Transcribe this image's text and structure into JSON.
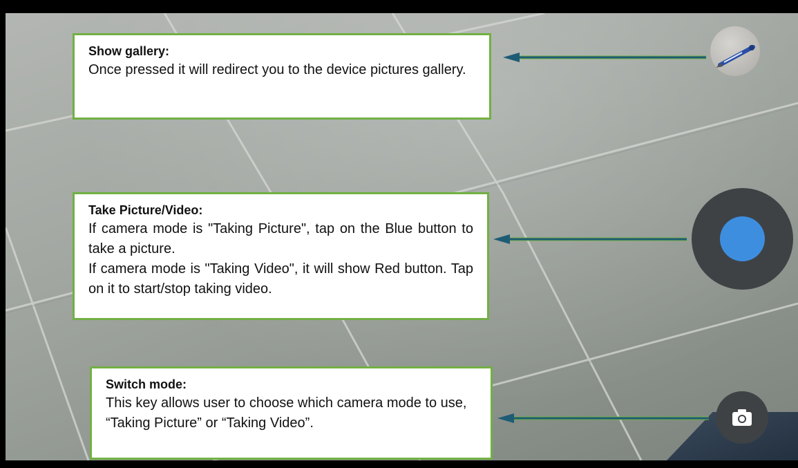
{
  "callouts": {
    "gallery": {
      "title": "Show gallery:",
      "body": "Once pressed it will redirect you to the device pictures gallery."
    },
    "take": {
      "title": "Take Picture/Video:",
      "body_line1": "If camera mode is \"Taking Picture\", tap on the Blue button to take a picture.",
      "body_line2": "If camera mode is \"Taking Video\", it will show Red button. Tap on it to start/stop taking video."
    },
    "switch": {
      "title": "Switch mode:",
      "body": "This key allows user to choose which camera mode to use, “Taking Picture” or “Taking Video”."
    }
  },
  "controls": {
    "gallery_button": {
      "icon": "pen-thumbnail-icon"
    },
    "capture_button": {
      "icon": "capture-dot-icon",
      "state": "Taking Picture",
      "dot_color": "#3e8ee0"
    },
    "switch_button": {
      "icon": "camera-icon"
    }
  },
  "colors": {
    "callout_border": "#72b043",
    "arrow": "#1d5c74",
    "capture_ring": "#3f4245"
  }
}
